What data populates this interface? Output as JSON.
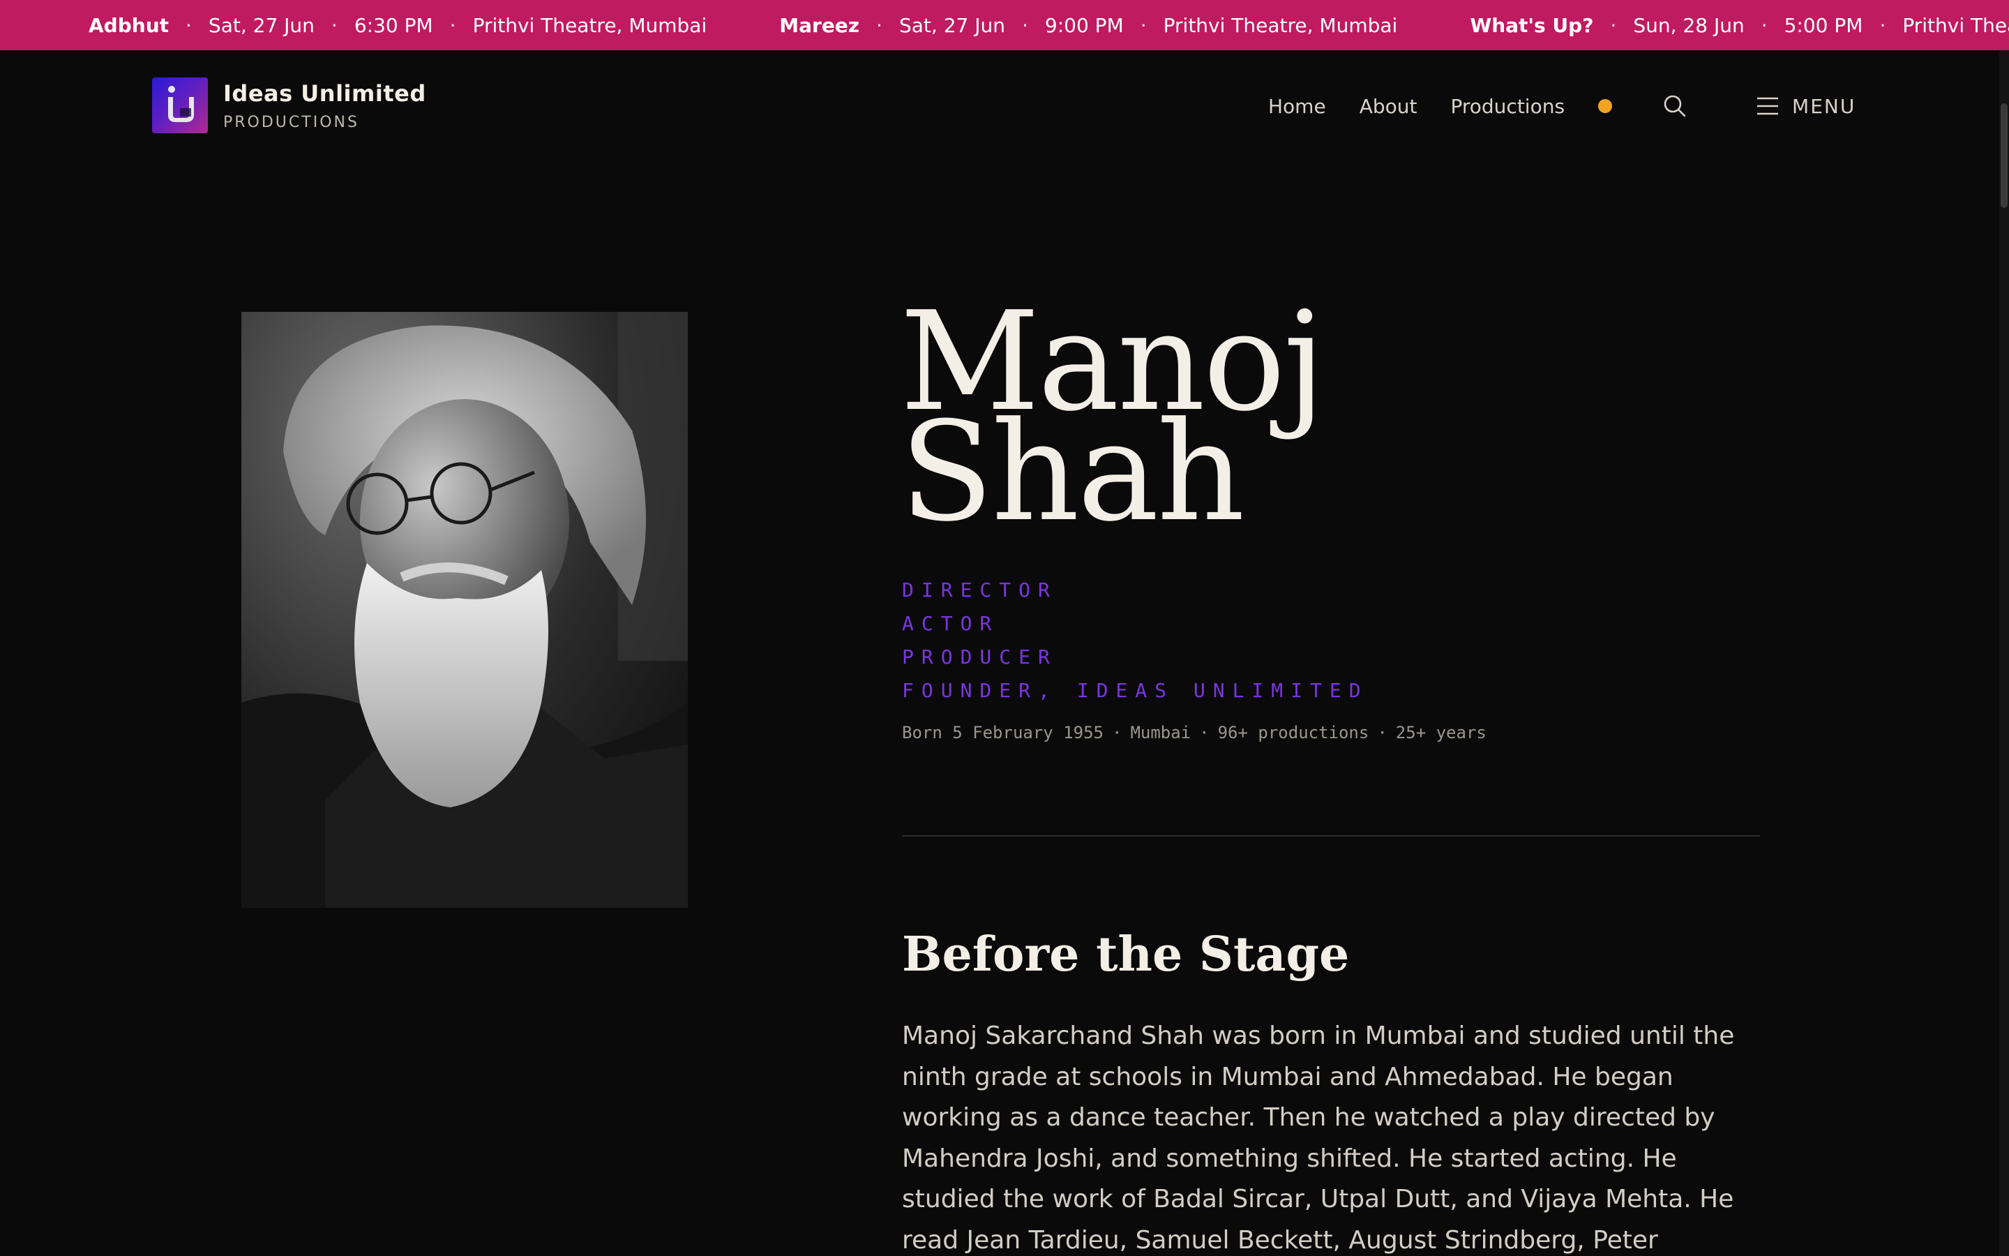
{
  "ticker": {
    "items": [
      {
        "title": "Adbhut",
        "date": "Sat, 27 Jun",
        "time": "6:30 PM",
        "venue": "Prithvi Theatre, Mumbai"
      },
      {
        "title": "Mareez",
        "date": "Sat, 27 Jun",
        "time": "9:00 PM",
        "venue": "Prithvi Theatre, Mumbai"
      },
      {
        "title": "What's Up?",
        "date": "Sun, 28 Jun",
        "time": "5:00 PM",
        "venue": "Prithvi Theatre, Mumbai"
      }
    ],
    "separator": "·",
    "bg_color": "#c01a60"
  },
  "brand": {
    "name": "Ideas Unlimited",
    "sub": "PRODUCTIONS"
  },
  "nav": {
    "home": "Home",
    "about": "About",
    "productions": "Productions",
    "menu": "MENU",
    "status_dot_color": "#f2a324",
    "icons": [
      "search-icon",
      "hamburger-icon"
    ]
  },
  "profile": {
    "name_first": "Manoj",
    "name_last": "Shah",
    "roles": [
      "DIRECTOR",
      "ACTOR",
      "PRODUCER",
      "FOUNDER, IDEAS UNLIMITED"
    ],
    "role_color": "#7a35e0",
    "meta": {
      "born": "Born 5 February 1955",
      "city": "Mumbai",
      "productions": "96+ productions",
      "years": "25+ years",
      "separator": "·"
    }
  },
  "section": {
    "title": "Before the Stage",
    "body": "Manoj Sakarchand Shah was born in Mumbai and studied until the ninth grade at schools in Mumbai and Ahmedabad. He began working as a dance teacher. Then he watched a play directed by Mahendra Joshi, and something shifted. He started acting. He studied the work of Badal Sircar, Utpal Dutt, and Vijaya Mehta. He read Jean Tardieu, Samuel Beckett, August Strindberg, Peter Handke, Robert Patrik, Chekhov. He performed in"
  }
}
